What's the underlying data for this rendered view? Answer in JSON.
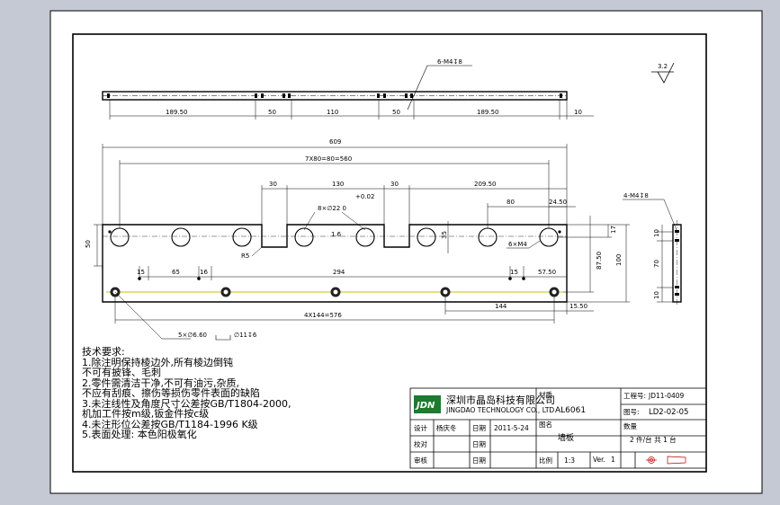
{
  "surface_finish": "3.2",
  "top_view": {
    "hole_note": "6-M4↧8",
    "dims": [
      "189.50",
      "50",
      "110",
      "50",
      "189.50",
      "10"
    ]
  },
  "front_view": {
    "overall_length": "609",
    "pitch_note": "7X80=80=560",
    "dim_30a": "30",
    "dim_130": "130",
    "dim_30b": "30",
    "dim_209": "209.50",
    "tolerance": "+0.02",
    "bore_note": "8×∅22  0",
    "dim_16": "1.6",
    "dim_80": "80",
    "dim_245": "24.50",
    "m4_note": "6×M4",
    "radius": "R5",
    "h_50": "50",
    "h_35": "35",
    "h_17": "17",
    "h_875": "87.50",
    "h_100": "100",
    "dim_15": "15",
    "dim_65": "65",
    "dim_16b": "16",
    "dim_294": "294",
    "dim_15b": "15",
    "dim_575": "57.50",
    "dim_144": "144",
    "dim_1550": "15.50",
    "hole_pitch": "4X144=576",
    "cbore_a": "5×∅6.60",
    "cbore_b": "∅11↧6"
  },
  "side_view": {
    "hole_note": "4-M4↧8",
    "dim_70": "70",
    "dim_10a": "10",
    "dim_10b": "10"
  },
  "notes": {
    "title": "技术要求:",
    "lines": [
      "1.除注明保持棱边外,所有棱边倒钝",
      "  不可有披锋、毛刺",
      "2.零件需清洁干净,不可有油污,杂质,",
      "  不应有刮痕、擦伤等损伤零件表面的缺陷",
      "3.未注线性及角度尺寸公差按GB/T1804-2000,",
      "  机加工件按m级,钣金件按c级",
      "4.未注形位公差按GB/T1184-1996 K级",
      "5.表面处理: 本色阳极氧化"
    ]
  },
  "title_block": {
    "logo_text": "JDN",
    "company_cn": "深圳市晶岛科技有限公司",
    "company_en": "JINGDAO TECHNOLOGY CO., LTD",
    "material_label": "材质",
    "material": "AL6061",
    "project_label": "工程号:",
    "project": "JD11-0409",
    "drawing_label": "图号:",
    "drawing": "LD2-02-05",
    "design_label": "设计",
    "designer": "杨庆冬",
    "date_label": "日期",
    "date": "2011-5-24",
    "name_label": "图名",
    "part_name": "墙板",
    "qty_label": "数量",
    "qty": "2 件/台    共 1 台",
    "check_label": "校对",
    "check_date_label": "日期",
    "approve_label": "审核",
    "approve_date_label": "日期",
    "scale_label": "比例",
    "scale": "1:3",
    "ver_label": "Ver.",
    "ver": "1"
  }
}
